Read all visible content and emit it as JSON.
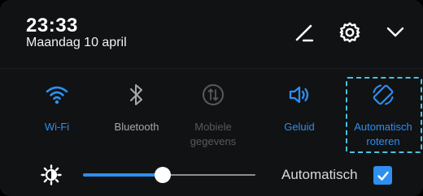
{
  "status": {
    "time": "23:33",
    "date": "Maandag 10 april"
  },
  "header_icons": [
    "edit-icon",
    "settings-gear-icon",
    "chevron-down-icon"
  ],
  "tiles": [
    {
      "label": "Wi-Fi",
      "icon": "wifi-icon",
      "state": "active"
    },
    {
      "label": "Bluetooth",
      "icon": "bluetooth-icon",
      "state": "inactive"
    },
    {
      "label": "Mobiele gegevens",
      "icon": "mobile-data-icon",
      "state": "disabled"
    },
    {
      "label": "Geluid",
      "icon": "sound-icon",
      "state": "active"
    },
    {
      "label": "Automatisch roteren",
      "icon": "auto-rotate-icon",
      "state": "active",
      "highlighted": true
    }
  ],
  "brightness": {
    "icon": "brightness-icon",
    "level": 0.46,
    "auto_label": "Automatisch",
    "auto_checked": true
  },
  "colors": {
    "background": "#111213",
    "active": "#2e8ff0",
    "inactive": "#a7a7a7",
    "disabled": "#595959",
    "highlight": "#48c3e4"
  }
}
